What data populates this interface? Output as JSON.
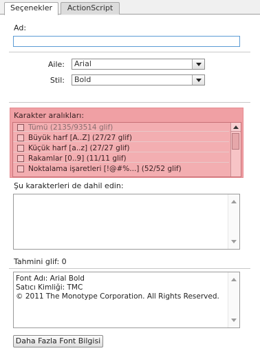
{
  "tabs": [
    {
      "label": "Seçenekler"
    },
    {
      "label": "ActionScript"
    }
  ],
  "name": {
    "label": "Ad:",
    "value": ""
  },
  "family": {
    "label": "Aile:",
    "value": "Arial"
  },
  "style": {
    "label": "Stil:",
    "value": "Bold"
  },
  "ranges": {
    "label": "Karakter aralıkları:",
    "items": [
      {
        "label": "Tümü  (2135/93514 glif)",
        "checked": false
      },
      {
        "label": "Büyük harf [A..Z]  (27/27 glif)",
        "checked": false
      },
      {
        "label": "Küçük harf [a..z]  (27/27 glif)",
        "checked": false
      },
      {
        "label": "Rakamlar [0..9]  (11/11 glif)",
        "checked": false
      },
      {
        "label": "Noktalama işaretleri [!@#%...]  (52/52 glif)",
        "checked": false
      }
    ]
  },
  "include": {
    "label": "Şu karakterleri de dahil edin:",
    "value": ""
  },
  "estimated": {
    "label": "Tahmini glif: 0"
  },
  "font_info": {
    "lines": [
      "Font Adı: Arial Bold",
      "Satıcı Kimliği: TMC",
      "© 2011 The Monotype Corporation. All Rights Reserved."
    ]
  },
  "more_button": {
    "label": "Daha Fazla Font Bilgisi"
  },
  "colors": {
    "highlight": "#f0a0a4",
    "focus_border": "#5b9bd5"
  }
}
